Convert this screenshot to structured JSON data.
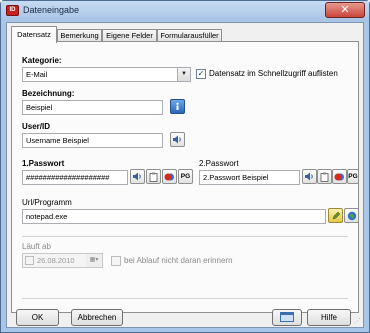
{
  "window": {
    "title": "Dateneingabe",
    "icon": "app-icon",
    "close_glyph": "✕"
  },
  "tabs": [
    {
      "label": "Datensatz",
      "active": true
    },
    {
      "label": "Bemerkung",
      "active": false
    },
    {
      "label": "Eigene Felder",
      "active": false
    },
    {
      "label": "Formularausfüller",
      "active": false
    }
  ],
  "form": {
    "kategorie": {
      "label": "Kategorie:",
      "value": "E-Mail"
    },
    "schnellzugriff": {
      "label": "Datensatz im Schnellzugriff auflisten",
      "checked": true
    },
    "bezeichnung": {
      "label": "Bezeichnung:",
      "value": "Beispiel"
    },
    "user": {
      "label": "User/ID",
      "value": "Username Beispiel"
    },
    "passwort1": {
      "label": "1.Passwort",
      "value": "####################"
    },
    "passwort2": {
      "label": "2.Passwort",
      "value": "2.Passwort Beispiel"
    },
    "url": {
      "label": "Url/Programm",
      "value": "notepad.exe"
    },
    "laeuft_ab": {
      "label": "Läuft ab",
      "date": "26.08.2010",
      "checked": false
    },
    "ablauf": {
      "label": "bei Ablauf nicht daran erinnern",
      "checked": false
    },
    "pg_label": "PG"
  },
  "buttons": {
    "ok": "OK",
    "abbrechen": "Abbrechen",
    "hilfe": "Hilfe"
  }
}
